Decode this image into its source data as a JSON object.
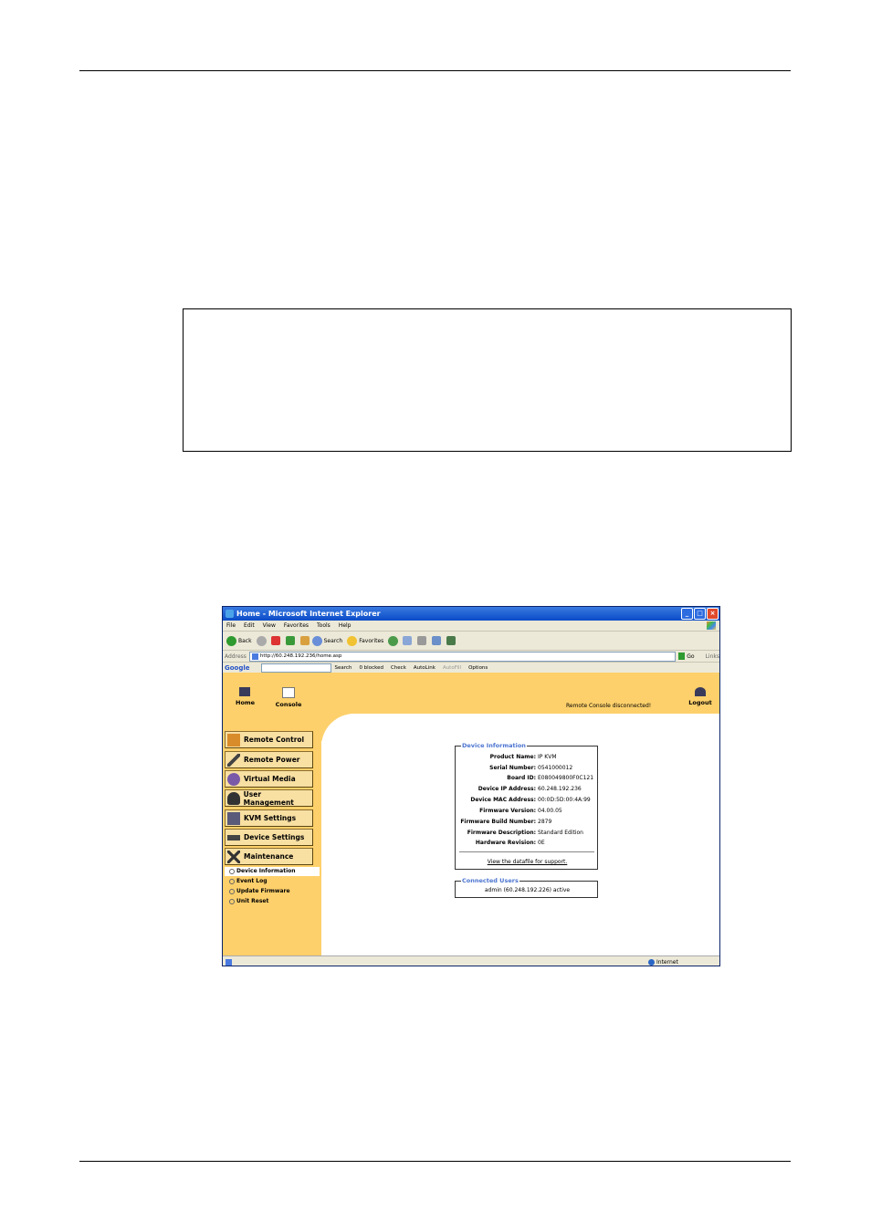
{
  "browser": {
    "title": "Home - Microsoft Internet Explorer",
    "menu": [
      "File",
      "Edit",
      "View",
      "Favorites",
      "Tools",
      "Help"
    ],
    "toolbar": {
      "back": "Back",
      "search": "Search",
      "favorites": "Favorites"
    },
    "address_label": "Address",
    "address_url": "http://60.248.192.236/home.asp",
    "go": "Go",
    "links": "Links",
    "google": {
      "logo": "Google",
      "search": "Search",
      "blocked": "0 blocked",
      "check": "Check",
      "autolink": "AutoLink",
      "autofill": "AutoFill",
      "options": "Options"
    },
    "status_zone": "Internet"
  },
  "app": {
    "nav": {
      "home": "Home",
      "console": "Console",
      "logout": "Logout"
    },
    "status_message": "Remote Console disconnected!",
    "menu": [
      "Remote Control",
      "Remote Power",
      "Virtual Media",
      "User Management",
      "KVM Settings",
      "Device Settings",
      "Maintenance"
    ],
    "submenu": [
      "Device Information",
      "Event Log",
      "Update Firmware",
      "Unit Reset"
    ],
    "device_info": {
      "title": "Device Information",
      "rows": [
        {
          "key": "Product Name:",
          "value": "IP KVM"
        },
        {
          "key": "Serial Number:",
          "value": "0541000012"
        },
        {
          "key": "Board ID:",
          "value": "E080049800F0C121"
        },
        {
          "key": "Device IP Address:",
          "value": "60.248.192.236"
        },
        {
          "key": "Device MAC Address:",
          "value": "00:0D:5D:00:4A:99"
        },
        {
          "key": "Firmware Version:",
          "value": "04.00.05"
        },
        {
          "key": "Firmware Build Number:",
          "value": "2879"
        },
        {
          "key": "Firmware Description:",
          "value": "Standard Edition"
        },
        {
          "key": "Hardware Revision:",
          "value": "0E"
        }
      ],
      "support_link": "View the datafile for support."
    },
    "connected_users": {
      "title": "Connected Users",
      "entry": "admin (60.248.192.226)  active"
    }
  }
}
